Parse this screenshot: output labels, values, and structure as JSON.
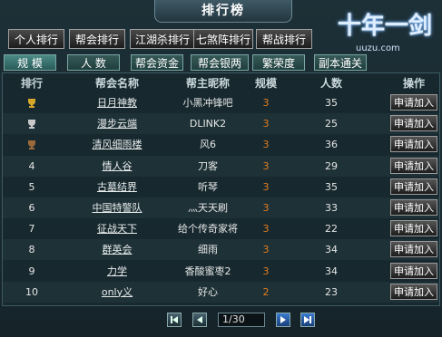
{
  "window": {
    "title": "排行榜"
  },
  "logo": {
    "text": "十年一剑",
    "url": "uuzu.com"
  },
  "primary_tabs": [
    {
      "label": "个人排行",
      "active": false
    },
    {
      "label": "帮会排行",
      "active": true
    },
    {
      "label": "江湖杀排行",
      "active": false
    },
    {
      "label": "七煞阵排行",
      "active": false
    },
    {
      "label": "帮战排行",
      "active": false
    }
  ],
  "secondary_tabs": [
    {
      "label": "规 模",
      "active": true
    },
    {
      "label": "人 数",
      "active": false
    },
    {
      "label": "帮会资金",
      "active": false
    },
    {
      "label": "帮会银两",
      "active": false
    },
    {
      "label": "繁荣度",
      "active": false
    },
    {
      "label": "副本通关",
      "active": false
    }
  ],
  "table": {
    "headers": [
      "排行",
      "帮会名称",
      "帮主昵称",
      "规模",
      "人数",
      "操作"
    ],
    "rows": [
      {
        "rank": "",
        "trophy": "gold",
        "guild": "日月神教",
        "leader": "小黑冲锋吧",
        "scale": "3",
        "members": "35",
        "action": "申请加入"
      },
      {
        "rank": "",
        "trophy": "silver",
        "guild": "漫步云端",
        "leader": "DLINK2",
        "scale": "3",
        "members": "25",
        "action": "申请加入"
      },
      {
        "rank": "",
        "trophy": "bronze",
        "guild": "清风细雨楼",
        "leader": "风6",
        "scale": "3",
        "members": "36",
        "action": "申请加入"
      },
      {
        "rank": "4",
        "trophy": "",
        "guild": "情人谷",
        "leader": "刀客",
        "scale": "3",
        "members": "29",
        "action": "申请加入"
      },
      {
        "rank": "5",
        "trophy": "",
        "guild": "古墓结界",
        "leader": "听琴",
        "scale": "3",
        "members": "35",
        "action": "申请加入"
      },
      {
        "rank": "6",
        "trophy": "",
        "guild": "中国特警队",
        "leader": "灬天天刷",
        "scale": "3",
        "members": "33",
        "action": "申请加入"
      },
      {
        "rank": "7",
        "trophy": "",
        "guild": "征战天下",
        "leader": "给个传奇家将",
        "scale": "3",
        "members": "22",
        "action": "申请加入"
      },
      {
        "rank": "8",
        "trophy": "",
        "guild": "群英会",
        "leader": "细雨",
        "scale": "3",
        "members": "34",
        "action": "申请加入"
      },
      {
        "rank": "9",
        "trophy": "",
        "guild": "力学",
        "leader": "香酸蜜枣2",
        "scale": "3",
        "members": "34",
        "action": "申请加入"
      },
      {
        "rank": "10",
        "trophy": "",
        "guild": "only义",
        "leader": "好心",
        "scale": "2",
        "members": "23",
        "action": "申请加入"
      }
    ]
  },
  "pager": {
    "value": "1/30"
  },
  "colors": {
    "scale": "#e07c1f",
    "gold": "#d7a72b",
    "silver": "#c9c9c9",
    "bronze": "#9c6a3a"
  }
}
